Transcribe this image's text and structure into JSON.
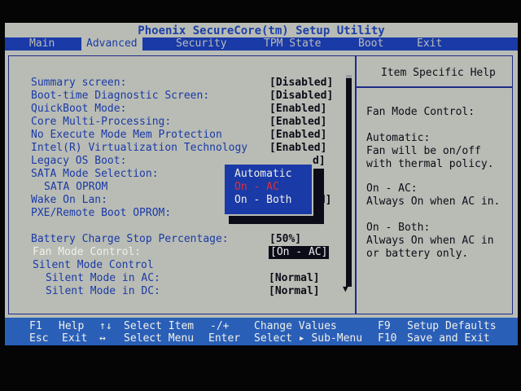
{
  "title": "Phoenix SecureCore(tm) Setup Utility",
  "menu": [
    {
      "label": "Main",
      "active": false
    },
    {
      "label": "Advanced",
      "active": true
    },
    {
      "label": "Security",
      "active": false
    },
    {
      "label": "TPM State",
      "active": false
    },
    {
      "label": "Boot",
      "active": false
    },
    {
      "label": "Exit",
      "active": false
    }
  ],
  "settings": [
    {
      "label": "Summary screen:",
      "value": "[Disabled]"
    },
    {
      "label": "Boot-time Diagnostic Screen:",
      "value": "[Disabled]"
    },
    {
      "label": "QuickBoot Mode:",
      "value": "[Enabled]"
    },
    {
      "label": "Core Multi-Processing:",
      "value": "[Enabled]"
    },
    {
      "label": "No Execute Mode Mem Protection",
      "value": "[Enabled]"
    },
    {
      "label": "Intel(R) Virtualization Technology",
      "value": "[Enabled]"
    },
    {
      "label": "Legacy OS Boot:",
      "value": "d]"
    },
    {
      "label": "SATA Mode Selection:",
      "value": ""
    },
    {
      "label": "SATA OPROM",
      "value": "d]"
    },
    {
      "label": "Wake On Lan:",
      "value": "ed]"
    },
    {
      "label": "PXE/Remote Boot OPROM:",
      "value": "d]"
    },
    {
      "label": "Battery Charge Stop Percentage:",
      "value": "[50%]"
    },
    {
      "label": "Fan Mode Control:",
      "value": "[On - AC]"
    },
    {
      "label": "Silent Mode Control",
      "value": ""
    },
    {
      "label": "Silent Mode in AC:",
      "value": "[Normal]"
    },
    {
      "label": "Silent Mode in DC:",
      "value": "[Normal]"
    }
  ],
  "popup": {
    "options": [
      "Automatic",
      "On - AC",
      "On - Both"
    ],
    "selected_index": 1
  },
  "help": {
    "title": "Item Specific Help",
    "lines": [
      "Fan Mode Control:",
      "",
      "Automatic:",
      "Fan will be on/off",
      "with thermal policy.",
      "",
      "On - AC:",
      "Always On when AC in.",
      "",
      "On - Both:",
      "Always On when AC in",
      "or battery only."
    ]
  },
  "footer": {
    "row1": [
      {
        "key": "F1",
        "desc": "Help"
      },
      {
        "key": "↑↓",
        "desc": "Select Item"
      },
      {
        "key": "-/+",
        "desc": "Change Values"
      },
      {
        "key": "F9",
        "desc": "Setup Defaults"
      }
    ],
    "row2": [
      {
        "key": "Esc",
        "desc": "Exit"
      },
      {
        "key": "↔",
        "desc": "Select Menu"
      },
      {
        "key": "Enter",
        "desc": "Select ▸ Sub-Menu"
      },
      {
        "key": "F10",
        "desc": "Save and Exit"
      }
    ]
  },
  "colors": {
    "background": "#b9bcb4",
    "accent_blue": "#1a3aa8",
    "footer_blue": "#2a5fb8",
    "popup_highlight": "#e03030"
  }
}
